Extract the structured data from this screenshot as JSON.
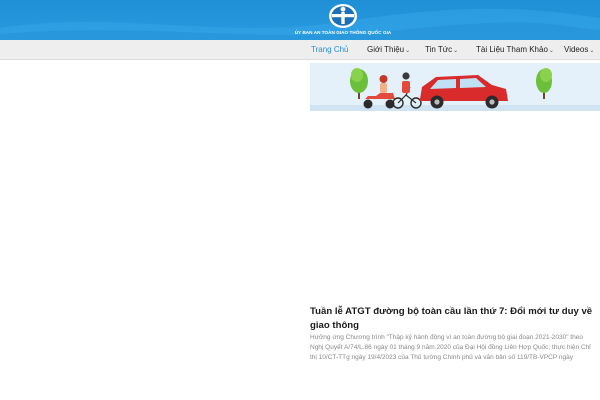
{
  "header": {
    "org_name": "ỦY BAN AN TOÀN GIAO THÔNG QUỐC GIA",
    "logo_icon": "traffic-safety-logo-icon",
    "bg_color": "#2a9be0"
  },
  "nav": {
    "items": [
      {
        "label": "Trang Chủ",
        "active": true,
        "dropdown": false
      },
      {
        "label": "Giới Thiệu",
        "active": false,
        "dropdown": true
      },
      {
        "label": "Tin Tức",
        "active": false,
        "dropdown": true
      },
      {
        "label": "Tài Liệu Tham Khảo",
        "active": false,
        "dropdown": true
      },
      {
        "label": "Videos",
        "active": false,
        "dropdown": true
      }
    ],
    "chevron": "⌄",
    "active_color": "#2a8fd4"
  },
  "article": {
    "title": "Tuần lễ ATGT đường bộ toàn cầu lần thứ 7: Đổi mới tư duy về giao thông",
    "excerpt": "Hưởng ứng Chương trình \"Thập kỷ hành động vì an toàn đường bộ giai đoạn 2021-2030\" theo Nghị Quyết A/74/L.86 ngày 01 tháng 9 năm 2020 của Đại Hội đồng Liên Hợp Quốc; thực hiện Chỉ thị 10/CT-TTg ngày 19/4/2023 của Thủ tướng Chính phủ và văn bản số 119/TB-VPCP ngày"
  }
}
